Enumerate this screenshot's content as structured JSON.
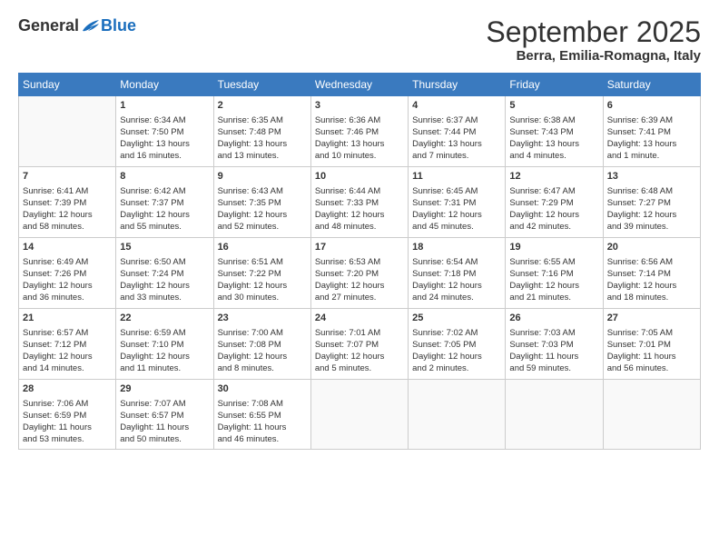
{
  "logo": {
    "general": "General",
    "blue": "Blue"
  },
  "header": {
    "month_year": "September 2025",
    "location": "Berra, Emilia-Romagna, Italy"
  },
  "weekdays": [
    "Sunday",
    "Monday",
    "Tuesday",
    "Wednesday",
    "Thursday",
    "Friday",
    "Saturday"
  ],
  "weeks": [
    [
      {
        "day": "",
        "content": ""
      },
      {
        "day": "1",
        "content": "Sunrise: 6:34 AM\nSunset: 7:50 PM\nDaylight: 13 hours\nand 16 minutes."
      },
      {
        "day": "2",
        "content": "Sunrise: 6:35 AM\nSunset: 7:48 PM\nDaylight: 13 hours\nand 13 minutes."
      },
      {
        "day": "3",
        "content": "Sunrise: 6:36 AM\nSunset: 7:46 PM\nDaylight: 13 hours\nand 10 minutes."
      },
      {
        "day": "4",
        "content": "Sunrise: 6:37 AM\nSunset: 7:44 PM\nDaylight: 13 hours\nand 7 minutes."
      },
      {
        "day": "5",
        "content": "Sunrise: 6:38 AM\nSunset: 7:43 PM\nDaylight: 13 hours\nand 4 minutes."
      },
      {
        "day": "6",
        "content": "Sunrise: 6:39 AM\nSunset: 7:41 PM\nDaylight: 13 hours\nand 1 minute."
      }
    ],
    [
      {
        "day": "7",
        "content": "Sunrise: 6:41 AM\nSunset: 7:39 PM\nDaylight: 12 hours\nand 58 minutes."
      },
      {
        "day": "8",
        "content": "Sunrise: 6:42 AM\nSunset: 7:37 PM\nDaylight: 12 hours\nand 55 minutes."
      },
      {
        "day": "9",
        "content": "Sunrise: 6:43 AM\nSunset: 7:35 PM\nDaylight: 12 hours\nand 52 minutes."
      },
      {
        "day": "10",
        "content": "Sunrise: 6:44 AM\nSunset: 7:33 PM\nDaylight: 12 hours\nand 48 minutes."
      },
      {
        "day": "11",
        "content": "Sunrise: 6:45 AM\nSunset: 7:31 PM\nDaylight: 12 hours\nand 45 minutes."
      },
      {
        "day": "12",
        "content": "Sunrise: 6:47 AM\nSunset: 7:29 PM\nDaylight: 12 hours\nand 42 minutes."
      },
      {
        "day": "13",
        "content": "Sunrise: 6:48 AM\nSunset: 7:27 PM\nDaylight: 12 hours\nand 39 minutes."
      }
    ],
    [
      {
        "day": "14",
        "content": "Sunrise: 6:49 AM\nSunset: 7:26 PM\nDaylight: 12 hours\nand 36 minutes."
      },
      {
        "day": "15",
        "content": "Sunrise: 6:50 AM\nSunset: 7:24 PM\nDaylight: 12 hours\nand 33 minutes."
      },
      {
        "day": "16",
        "content": "Sunrise: 6:51 AM\nSunset: 7:22 PM\nDaylight: 12 hours\nand 30 minutes."
      },
      {
        "day": "17",
        "content": "Sunrise: 6:53 AM\nSunset: 7:20 PM\nDaylight: 12 hours\nand 27 minutes."
      },
      {
        "day": "18",
        "content": "Sunrise: 6:54 AM\nSunset: 7:18 PM\nDaylight: 12 hours\nand 24 minutes."
      },
      {
        "day": "19",
        "content": "Sunrise: 6:55 AM\nSunset: 7:16 PM\nDaylight: 12 hours\nand 21 minutes."
      },
      {
        "day": "20",
        "content": "Sunrise: 6:56 AM\nSunset: 7:14 PM\nDaylight: 12 hours\nand 18 minutes."
      }
    ],
    [
      {
        "day": "21",
        "content": "Sunrise: 6:57 AM\nSunset: 7:12 PM\nDaylight: 12 hours\nand 14 minutes."
      },
      {
        "day": "22",
        "content": "Sunrise: 6:59 AM\nSunset: 7:10 PM\nDaylight: 12 hours\nand 11 minutes."
      },
      {
        "day": "23",
        "content": "Sunrise: 7:00 AM\nSunset: 7:08 PM\nDaylight: 12 hours\nand 8 minutes."
      },
      {
        "day": "24",
        "content": "Sunrise: 7:01 AM\nSunset: 7:07 PM\nDaylight: 12 hours\nand 5 minutes."
      },
      {
        "day": "25",
        "content": "Sunrise: 7:02 AM\nSunset: 7:05 PM\nDaylight: 12 hours\nand 2 minutes."
      },
      {
        "day": "26",
        "content": "Sunrise: 7:03 AM\nSunset: 7:03 PM\nDaylight: 11 hours\nand 59 minutes."
      },
      {
        "day": "27",
        "content": "Sunrise: 7:05 AM\nSunset: 7:01 PM\nDaylight: 11 hours\nand 56 minutes."
      }
    ],
    [
      {
        "day": "28",
        "content": "Sunrise: 7:06 AM\nSunset: 6:59 PM\nDaylight: 11 hours\nand 53 minutes."
      },
      {
        "day": "29",
        "content": "Sunrise: 7:07 AM\nSunset: 6:57 PM\nDaylight: 11 hours\nand 50 minutes."
      },
      {
        "day": "30",
        "content": "Sunrise: 7:08 AM\nSunset: 6:55 PM\nDaylight: 11 hours\nand 46 minutes."
      },
      {
        "day": "",
        "content": ""
      },
      {
        "day": "",
        "content": ""
      },
      {
        "day": "",
        "content": ""
      },
      {
        "day": "",
        "content": ""
      }
    ]
  ]
}
